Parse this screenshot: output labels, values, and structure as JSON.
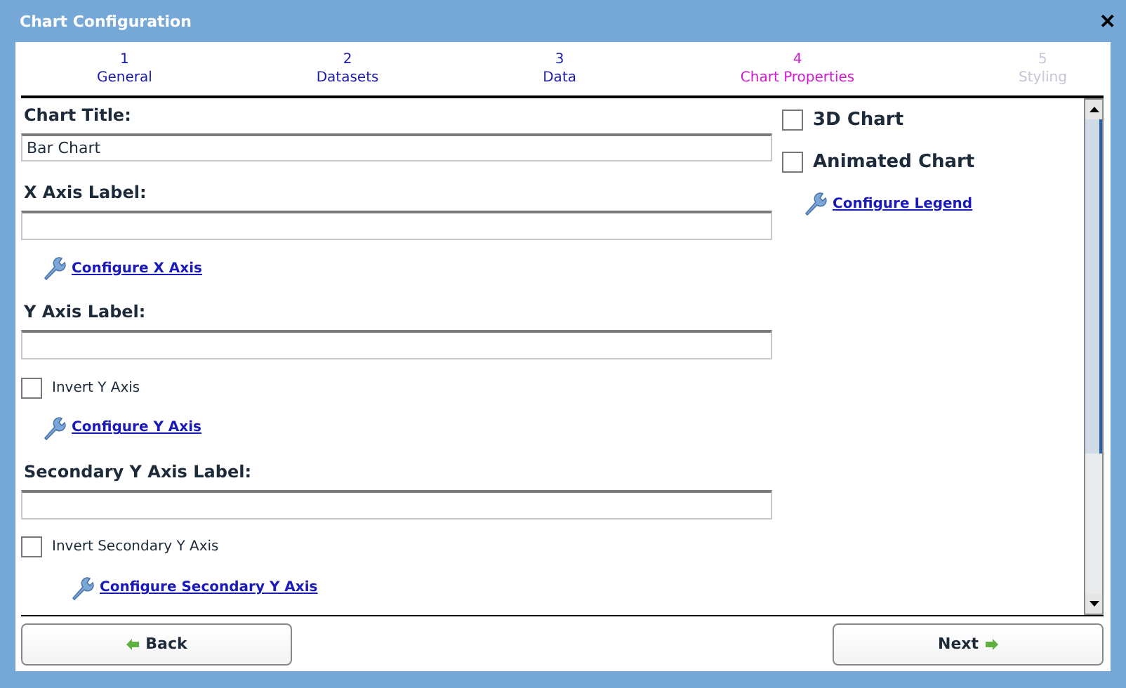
{
  "window": {
    "title": "Chart Configuration",
    "close": "✕"
  },
  "steps": [
    {
      "number": "1",
      "label": "General",
      "selected": false,
      "disabled": false
    },
    {
      "number": "2",
      "label": "Datasets",
      "selected": false,
      "disabled": false
    },
    {
      "number": "3",
      "label": "Data",
      "selected": false,
      "disabled": false
    },
    {
      "number": "4",
      "label": "Chart Properties",
      "selected": true,
      "disabled": false
    },
    {
      "number": "5",
      "label": "Styling",
      "selected": false,
      "disabled": true
    }
  ],
  "left_fields": [
    {
      "kind": "label",
      "text": "Chart Title:"
    },
    {
      "kind": "input",
      "value": "Bar Chart"
    },
    {
      "kind": "label",
      "text": "X Axis Label:"
    },
    {
      "kind": "input"
    },
    {
      "kind": "link",
      "text": "Configure X Axis"
    },
    {
      "kind": "label",
      "text": "Y Axis Label:"
    },
    {
      "kind": "input"
    },
    {
      "kind": "checkbox",
      "text": "Invert Y Axis",
      "checked": false
    },
    {
      "kind": "link",
      "text": "Configure Y Axis"
    },
    {
      "kind": "label",
      "text": "Secondary Y Axis Label:"
    },
    {
      "kind": "input"
    },
    {
      "kind": "checkbox",
      "text": "Invert Secondary Y Axis",
      "checked": false
    },
    {
      "kind": "sublink",
      "text": "Configure Secondary Y Axis"
    }
  ],
  "right_fields": [
    {
      "kind": "bigcheckbox",
      "text": "3D Chart",
      "checked": false
    },
    {
      "kind": "bigcheckbox",
      "text": "Animated Chart",
      "checked": false
    },
    {
      "kind": "link",
      "text": "Configure Legend"
    }
  ],
  "buttons": [
    {
      "kind": "back",
      "label": "Back"
    },
    {
      "kind": "next",
      "label": "Next"
    }
  ]
}
